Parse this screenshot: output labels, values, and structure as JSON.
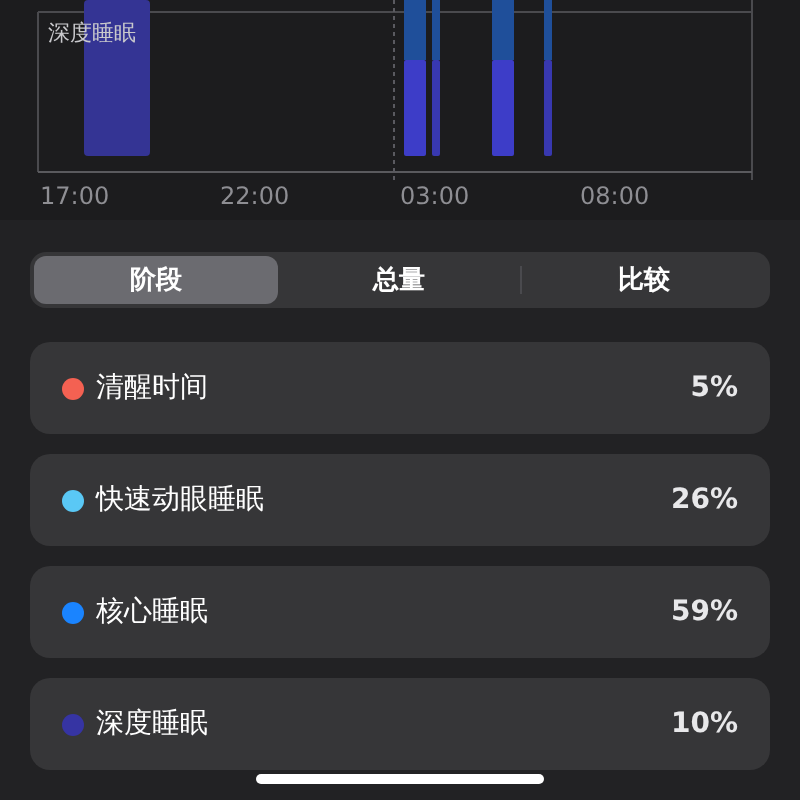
{
  "chart": {
    "stage_label": "深度睡眠",
    "x_labels": [
      "17:00",
      "22:00",
      "03:00",
      "08:00"
    ]
  },
  "tabs": [
    {
      "label": "阶段",
      "selected": true
    },
    {
      "label": "总量",
      "selected": false
    },
    {
      "label": "比较",
      "selected": false
    }
  ],
  "stages": [
    {
      "name": "清醒时间",
      "value": "5%",
      "color": "#f46152"
    },
    {
      "name": "快速动眼睡眠",
      "value": "26%",
      "color": "#5ac8f5"
    },
    {
      "name": "核心睡眠",
      "value": "59%",
      "color": "#1a84ff"
    },
    {
      "name": "深度睡眠",
      "value": "10%",
      "color": "#3634a3"
    }
  ]
}
